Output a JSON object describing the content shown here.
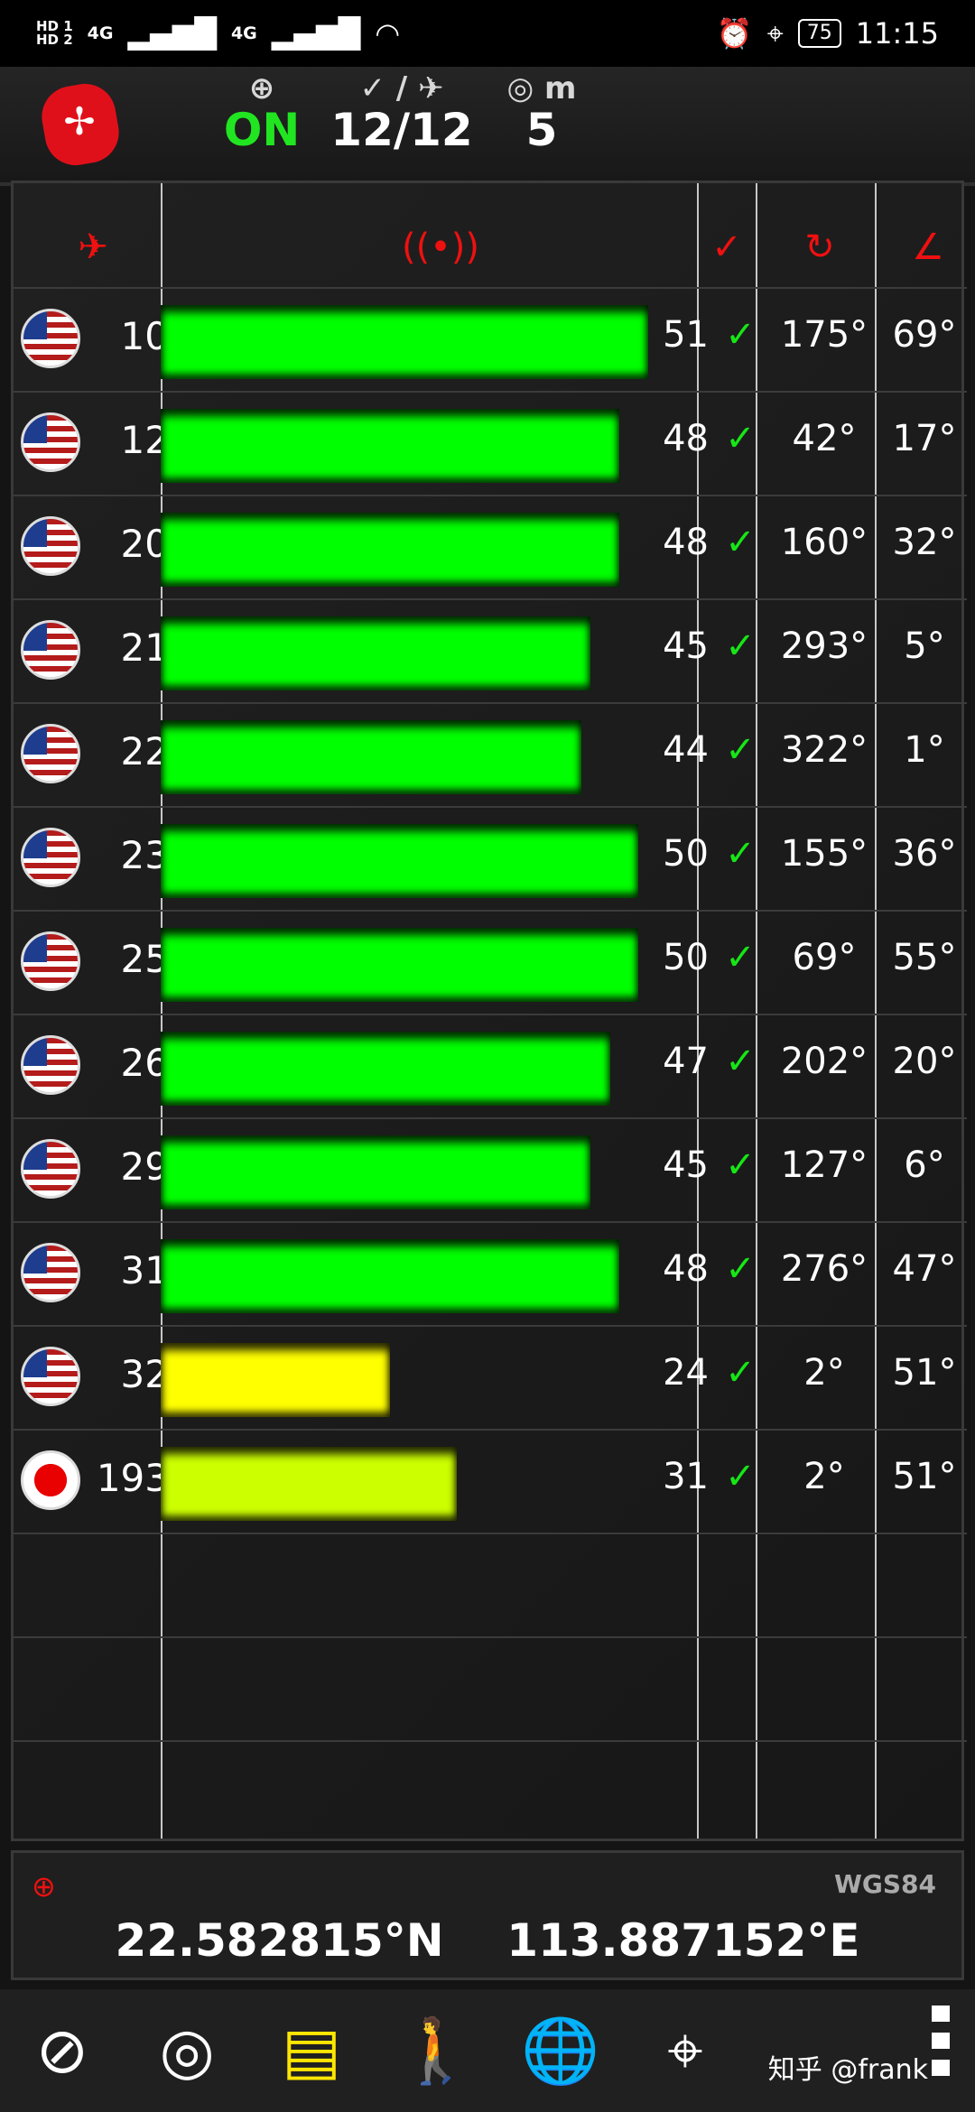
{
  "status_bar": {
    "hd1": "HD 1",
    "hd2": "HD 2",
    "network1": "4G",
    "network2": "4G",
    "battery": "75",
    "time": "11:15"
  },
  "top": {
    "gps_status": "ON",
    "satellites": "12/12",
    "accuracy": "5",
    "accuracy_unit": "m"
  },
  "icons": {
    "satellite": "satellite-icon",
    "signal": "signal-icon",
    "used": "check-icon",
    "azimuth": "azimuth-icon",
    "elevation": "elevation-icon"
  },
  "satellites": [
    {
      "flag": "us",
      "id": "10",
      "snr": "51",
      "snr_value": 51,
      "used": "✓",
      "azimuth": "175°",
      "elevation": "69°"
    },
    {
      "flag": "us",
      "id": "12",
      "snr": "48",
      "snr_value": 48,
      "used": "✓",
      "azimuth": "42°",
      "elevation": "17°"
    },
    {
      "flag": "us",
      "id": "20",
      "snr": "48",
      "snr_value": 48,
      "used": "✓",
      "azimuth": "160°",
      "elevation": "32°"
    },
    {
      "flag": "us",
      "id": "21",
      "snr": "45",
      "snr_value": 45,
      "used": "✓",
      "azimuth": "293°",
      "elevation": "5°"
    },
    {
      "flag": "us",
      "id": "22",
      "snr": "44",
      "snr_value": 44,
      "used": "✓",
      "azimuth": "322°",
      "elevation": "1°"
    },
    {
      "flag": "us",
      "id": "23",
      "snr": "50",
      "snr_value": 50,
      "used": "✓",
      "azimuth": "155°",
      "elevation": "36°"
    },
    {
      "flag": "us",
      "id": "25",
      "snr": "50",
      "snr_value": 50,
      "used": "✓",
      "azimuth": "69°",
      "elevation": "55°"
    },
    {
      "flag": "us",
      "id": "26",
      "snr": "47",
      "snr_value": 47,
      "used": "✓",
      "azimuth": "202°",
      "elevation": "20°"
    },
    {
      "flag": "us",
      "id": "29",
      "snr": "45",
      "snr_value": 45,
      "used": "✓",
      "azimuth": "127°",
      "elevation": "6°"
    },
    {
      "flag": "us",
      "id": "31",
      "snr": "48",
      "snr_value": 48,
      "used": "✓",
      "azimuth": "276°",
      "elevation": "47°"
    },
    {
      "flag": "us",
      "id": "32",
      "snr": "24",
      "snr_value": 24,
      "used": "✓",
      "azimuth": "2°",
      "elevation": "51°"
    },
    {
      "flag": "jp",
      "id": "193",
      "snr": "31",
      "snr_value": 31,
      "used": "✓",
      "azimuth": "2°",
      "elevation": "51°"
    }
  ],
  "coordinates": {
    "datum": "WGS84",
    "latitude": "22.582815°N",
    "longitude": "113.887152°E"
  },
  "watermark": "知乎 @frank",
  "colors": {
    "strong_signal": "#00ff00",
    "weak_signal": "#ffff00",
    "medium_signal": "#ccff00",
    "accent": "#ef1010"
  }
}
